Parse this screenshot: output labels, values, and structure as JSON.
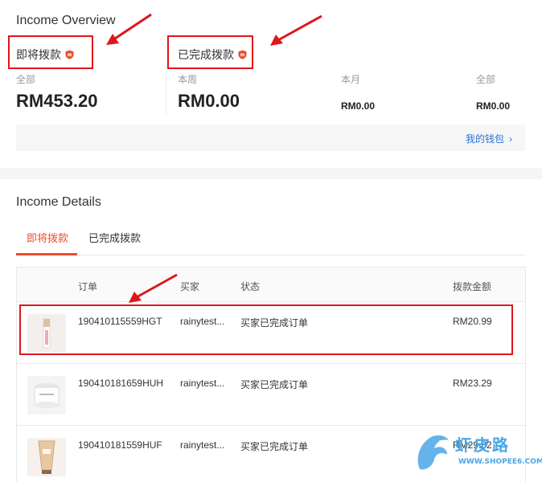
{
  "overview": {
    "title": "Income Overview",
    "pending": {
      "title": "即将拨款",
      "label": "全部",
      "amount": "RM453.20"
    },
    "completed": {
      "title": "已完成拨款",
      "week_label": "本周",
      "week_amount": "RM0.00",
      "month_label": "本月",
      "month_amount": "RM0.00",
      "all_label": "全部",
      "all_amount": "RM0.00"
    },
    "wallet_link": "我的钱包"
  },
  "details": {
    "title": "Income Details",
    "tabs": [
      {
        "label": "即将拨款",
        "active": true
      },
      {
        "label": "已完成拨款",
        "active": false
      }
    ],
    "columns": {
      "order": "订单",
      "buyer": "买家",
      "status": "状态",
      "amount": "拨款金额"
    },
    "rows": [
      {
        "order": "190410115559HGT",
        "buyer": "rainytest...",
        "status": "买家已完成订单",
        "amount": "RM20.99",
        "thumb_icon": "lipgloss-product-icon"
      },
      {
        "order": "190410181659HUH",
        "buyer": "rainytest...",
        "status": "买家已完成订单",
        "amount": "RM23.29",
        "thumb_icon": "cream-jar-product-icon"
      },
      {
        "order": "190410181559HUF",
        "buyer": "rainytest...",
        "status": "买家已完成订单",
        "amount": "RM29.82",
        "thumb_icon": "tube-product-icon"
      }
    ]
  },
  "watermark": {
    "text": "虾皮路",
    "url": "WWW.SHOPEE6.COM"
  },
  "colors": {
    "accent": "#ee4d2d",
    "link": "#2673dd",
    "annotation": "#e0161c"
  }
}
